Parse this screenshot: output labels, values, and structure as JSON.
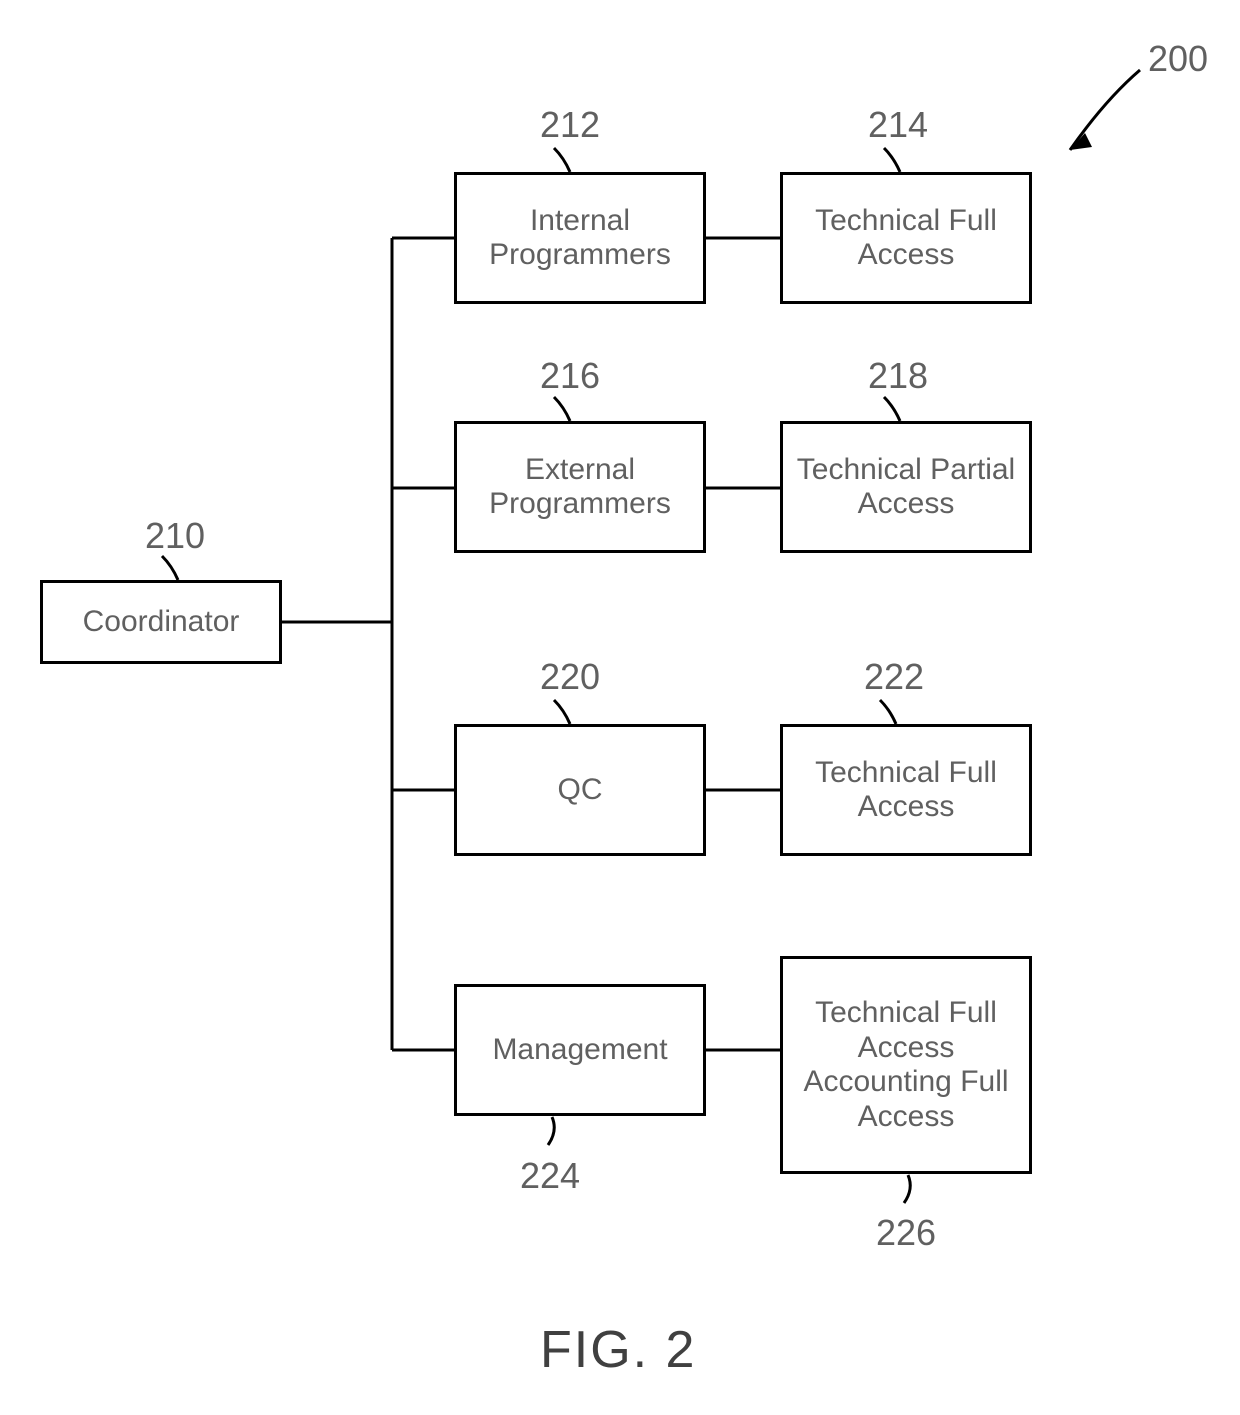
{
  "figure_label": "FIG. 2",
  "boxes": {
    "coordinator": {
      "ref": "210",
      "text": "Coordinator"
    },
    "internal_programmers": {
      "ref": "212",
      "text": "Internal Programmers"
    },
    "technical_full_access_1": {
      "ref": "214",
      "text": "Technical Full Access"
    },
    "external_programmers": {
      "ref": "216",
      "text": "External Programmers"
    },
    "technical_partial": {
      "ref": "218",
      "text": "Technical Partial Access"
    },
    "qc": {
      "ref": "220",
      "text": "QC"
    },
    "technical_full_access_2": {
      "ref": "222",
      "text": "Technical Full Access"
    },
    "management": {
      "ref": "224",
      "text": "Management"
    },
    "management_access": {
      "ref": "226",
      "text": "Technical Full Access Accounting Full Access"
    }
  },
  "overall_ref": "200"
}
